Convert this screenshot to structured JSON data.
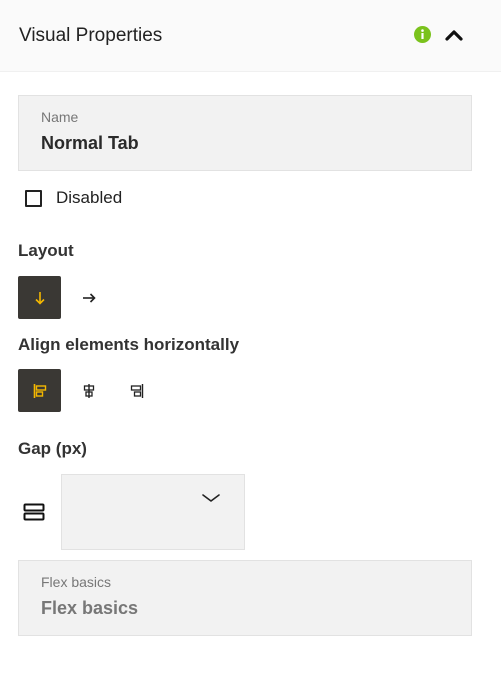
{
  "header": {
    "title": "Visual Properties",
    "info_icon": "info-icon",
    "collapse_icon": "chevron-up-icon"
  },
  "name_field": {
    "label": "Name",
    "value": "Normal Tab"
  },
  "disabled": {
    "label": "Disabled",
    "checked": false
  },
  "layout": {
    "title": "Layout",
    "options": [
      {
        "icon": "arrow-down-icon",
        "selected": true
      },
      {
        "icon": "arrow-right-icon",
        "selected": false
      }
    ]
  },
  "align": {
    "title": "Align elements horizontally",
    "options": [
      {
        "icon": "align-left-icon",
        "selected": true
      },
      {
        "icon": "align-center-icon",
        "selected": false
      },
      {
        "icon": "align-right-icon",
        "selected": false
      }
    ]
  },
  "gap": {
    "title": "Gap (px)",
    "icon": "row-gap-icon",
    "value": ""
  },
  "flex_basics": {
    "label": "Flex basics",
    "placeholder": "Flex basics"
  },
  "colors": {
    "accent": "#f5b800",
    "info": "#7ac21c",
    "active_bg": "#3a3834",
    "field_bg": "#f2f2f2"
  }
}
